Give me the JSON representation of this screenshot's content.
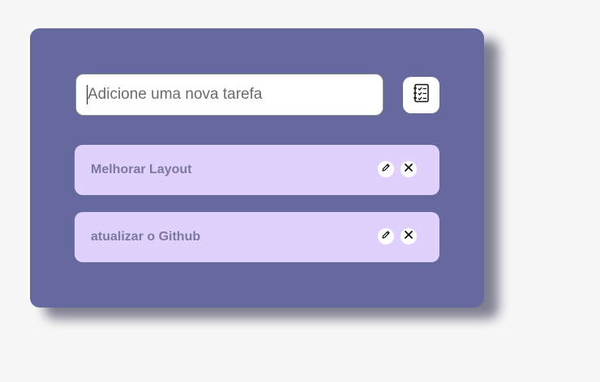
{
  "new_task": {
    "placeholder": "Adicione uma nova tarefa",
    "value": ""
  },
  "add_button": {
    "icon": "checklist-icon"
  },
  "tasks": [
    {
      "label": "Melhorar Layout",
      "edit_icon": "pencil-icon",
      "delete_icon": "close-icon"
    },
    {
      "label": "atualizar o Github",
      "edit_icon": "pencil-icon",
      "delete_icon": "close-icon"
    }
  ],
  "colors": {
    "page_background": "#f7f7f7",
    "card_background": "#66699e",
    "task_background": "#dfd0fc",
    "task_text": "#7d78a0"
  }
}
